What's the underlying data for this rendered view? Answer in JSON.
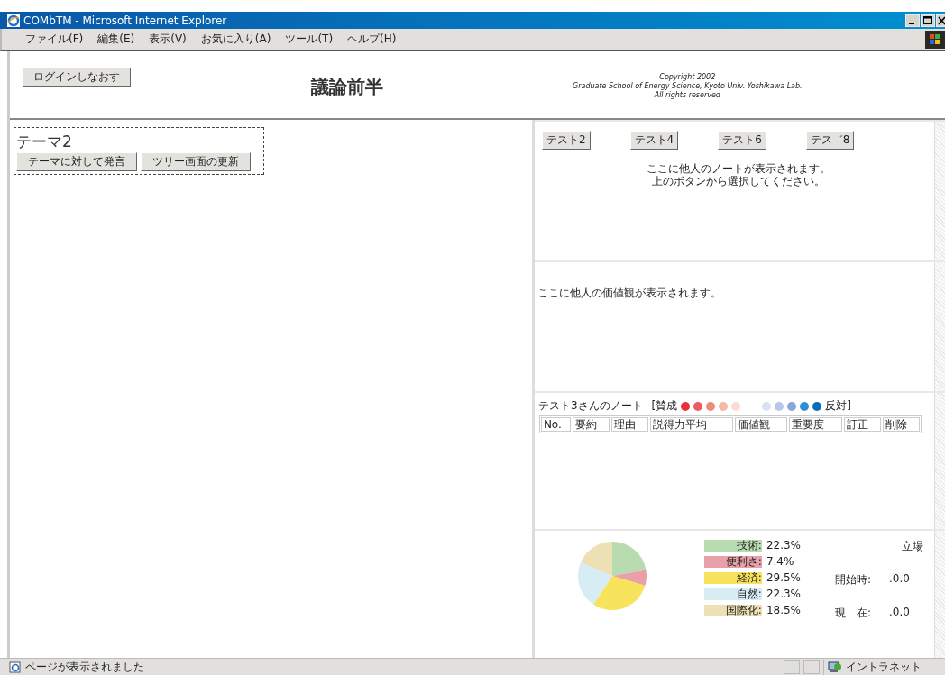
{
  "window": {
    "title": "COMbTM - Microsoft Internet Explorer"
  },
  "menu": [
    "ファイル(F)",
    "編集(E)",
    "表示(V)",
    "お気に入り(A)",
    "ツール(T)",
    "ヘルプ(H)"
  ],
  "header": {
    "login_button": "ログインしなおす",
    "title": "議論前半",
    "copyright": [
      "Copyright 2002",
      "Graduate School of Energy Science, Kyoto Univ. Yoshikawa Lab.",
      "All rights reserved"
    ]
  },
  "theme": {
    "title": "テーマ2",
    "buttons": [
      "テーマに対して発言",
      "ツリー画面の更新"
    ]
  },
  "user_buttons": [
    "テスト2",
    "テスト4",
    "テスト6",
    "テス゛8"
  ],
  "note_hint": [
    "ここに他人のノートが表示されます。",
    "上のボタンから選択してください。"
  ],
  "value_hint": "ここに他人の価値観が表示されます。",
  "note": {
    "title": "テスト3さんのノート",
    "agree_label": "[賛成",
    "disagree_label": "反対]",
    "dots": [
      {
        "color": "#e8303a"
      },
      {
        "color": "#ee5a5e"
      },
      {
        "color": "#f08a78"
      },
      {
        "color": "#f6b8a4"
      },
      {
        "color": "#fbdcd2"
      },
      {
        "color": "#d8e2f2"
      },
      {
        "color": "#b4c8e8"
      },
      {
        "color": "#84a8dc"
      },
      {
        "color": "#2e90d4"
      },
      {
        "color": "#0a6cb8"
      }
    ],
    "columns": [
      "No.",
      "要約",
      "理由",
      "説得力平均",
      "価値観",
      "重要度",
      "訂正",
      "削除"
    ]
  },
  "values_chart": {
    "chart_data": {
      "type": "pie",
      "categories": [
        "技術",
        "便利さ",
        "経済",
        "自然",
        "国際化"
      ],
      "values": [
        22.3,
        7.4,
        29.5,
        22.3,
        18.5
      ]
    },
    "legend": [
      {
        "separator": ":",
        "value": "22.3%",
        "color": "#b8dcb0"
      },
      {
        "separator": ":",
        "value": "7.4%",
        "color": "#eaa0a8"
      },
      {
        "separator": ":",
        "value": "29.5%",
        "color": "#f8e45c"
      },
      {
        "separator": ":",
        "value": "22.3%",
        "color": "#d8ecf4"
      },
      {
        "separator": ":",
        "value": "18.5%",
        "color": "#ece0b4"
      }
    ]
  },
  "stance": {
    "title": "立場",
    "rows": [
      {
        "label": "開始時:",
        "value": ".0.0"
      },
      {
        "label": "現　在:",
        "value": ".0.0"
      }
    ]
  },
  "status_bar": {
    "message": "ページが表示されました",
    "zone": "イントラネット"
  }
}
